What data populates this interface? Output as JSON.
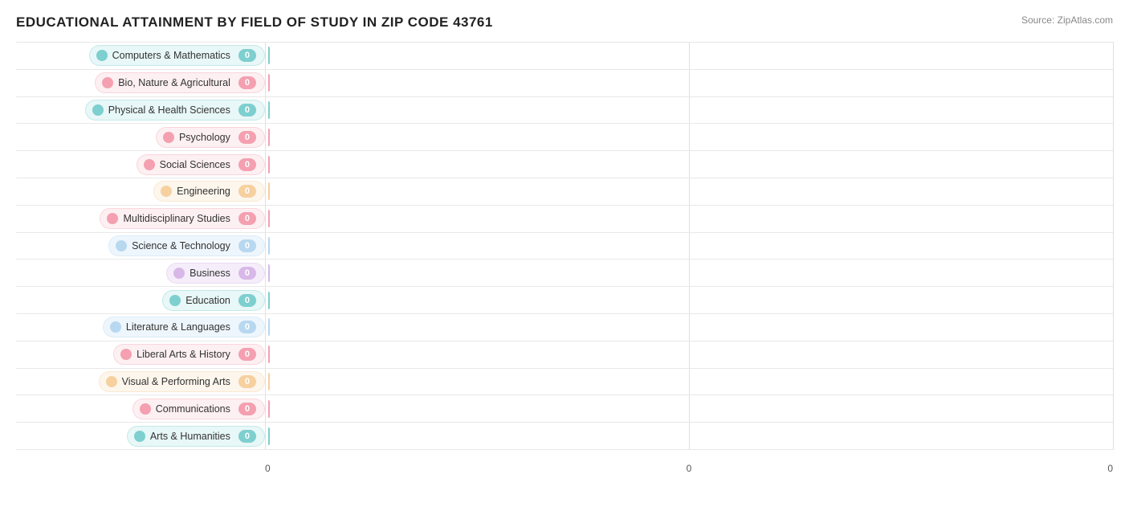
{
  "chart": {
    "title": "EDUCATIONAL ATTAINMENT BY FIELD OF STUDY IN ZIP CODE 43761",
    "source": "Source: ZipAtlas.com",
    "x_axis_labels": [
      "0",
      "0",
      "0"
    ],
    "rows": [
      {
        "label": "Computers & Mathematics",
        "value": 0,
        "dot_color": "#7ecfcf",
        "bar_color": "#7ecfcf",
        "badge_color": "#7ecfcf",
        "pill_bg": "#e8f7f7"
      },
      {
        "label": "Bio, Nature & Agricultural",
        "value": 0,
        "dot_color": "#f4a0b0",
        "bar_color": "#f4a0b0",
        "badge_color": "#f4a0b0",
        "pill_bg": "#fdf0f2"
      },
      {
        "label": "Physical & Health Sciences",
        "value": 0,
        "dot_color": "#7ecfcf",
        "bar_color": "#7ecfcf",
        "badge_color": "#7ecfcf",
        "pill_bg": "#e8f7f7"
      },
      {
        "label": "Psychology",
        "value": 0,
        "dot_color": "#f4a0b0",
        "bar_color": "#f4a0b0",
        "badge_color": "#f4a0b0",
        "pill_bg": "#fdf0f2"
      },
      {
        "label": "Social Sciences",
        "value": 0,
        "dot_color": "#f4a0b0",
        "bar_color": "#f4a0b0",
        "badge_color": "#f4a0b0",
        "pill_bg": "#fdf0f2"
      },
      {
        "label": "Engineering",
        "value": 0,
        "dot_color": "#f7d0a0",
        "bar_color": "#f7d0a0",
        "badge_color": "#f7d0a0",
        "pill_bg": "#fdf6ec"
      },
      {
        "label": "Multidisciplinary Studies",
        "value": 0,
        "dot_color": "#f4a0b0",
        "bar_color": "#f4a0b0",
        "badge_color": "#f4a0b0",
        "pill_bg": "#fdf0f2"
      },
      {
        "label": "Science & Technology",
        "value": 0,
        "dot_color": "#b8d8f0",
        "bar_color": "#b8d8f0",
        "badge_color": "#b8d8f0",
        "pill_bg": "#eef6fd"
      },
      {
        "label": "Business",
        "value": 0,
        "dot_color": "#d8b8e8",
        "bar_color": "#d8b8e8",
        "badge_color": "#d8b8e8",
        "pill_bg": "#f5eefa"
      },
      {
        "label": "Education",
        "value": 0,
        "dot_color": "#7ecfcf",
        "bar_color": "#7ecfcf",
        "badge_color": "#7ecfcf",
        "pill_bg": "#e8f7f7"
      },
      {
        "label": "Literature & Languages",
        "value": 0,
        "dot_color": "#b8d8f0",
        "bar_color": "#b8d8f0",
        "badge_color": "#b8d8f0",
        "pill_bg": "#eef6fd"
      },
      {
        "label": "Liberal Arts & History",
        "value": 0,
        "dot_color": "#f4a0b0",
        "bar_color": "#f4a0b0",
        "badge_color": "#f4a0b0",
        "pill_bg": "#fdf0f2"
      },
      {
        "label": "Visual & Performing Arts",
        "value": 0,
        "dot_color": "#f7d0a0",
        "bar_color": "#f7d0a0",
        "badge_color": "#f7d0a0",
        "pill_bg": "#fdf6ec"
      },
      {
        "label": "Communications",
        "value": 0,
        "dot_color": "#f4a0b0",
        "bar_color": "#f4a0b0",
        "badge_color": "#f4a0b0",
        "pill_bg": "#fdf0f2"
      },
      {
        "label": "Arts & Humanities",
        "value": 0,
        "dot_color": "#7ecfcf",
        "bar_color": "#7ecfcf",
        "badge_color": "#7ecfcf",
        "pill_bg": "#e8f7f7"
      }
    ]
  }
}
